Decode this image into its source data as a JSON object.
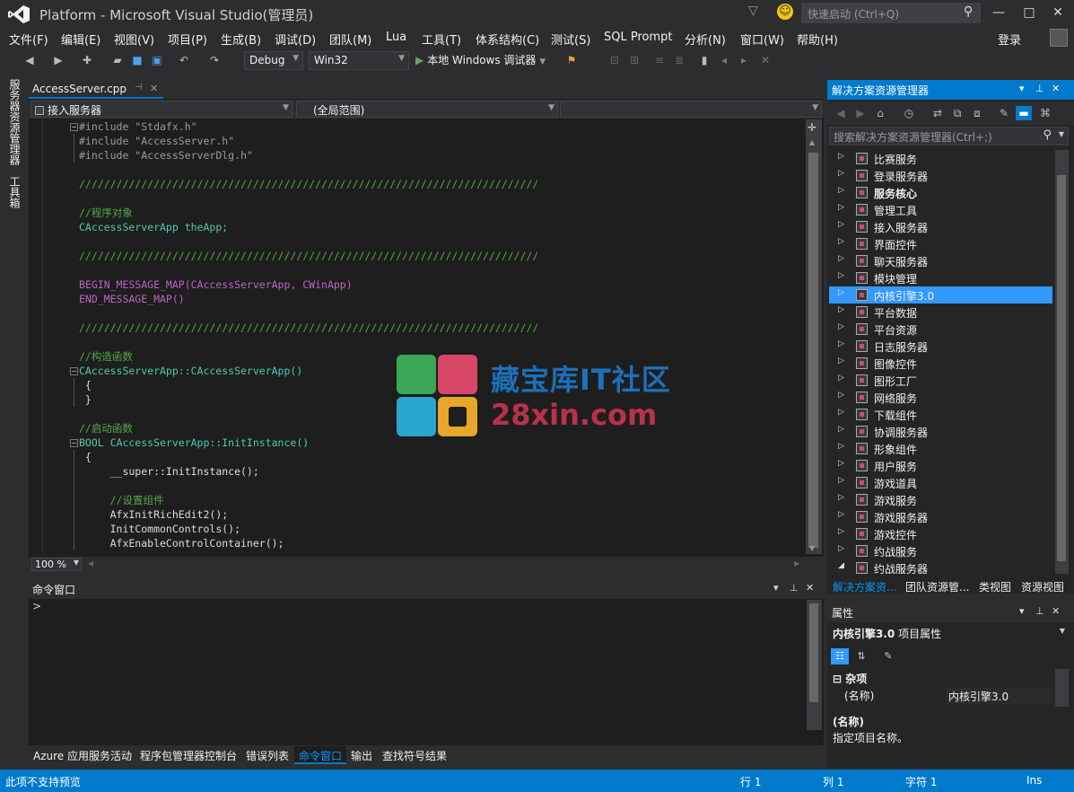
{
  "window": {
    "title": "Platform - Microsoft Visual Studio(管理员)",
    "quick_launch_placeholder": "快速启动 (Ctrl+Q)",
    "sign_in": "登录"
  },
  "menu": [
    "文件(F)",
    "编辑(E)",
    "视图(V)",
    "项目(P)",
    "生成(B)",
    "调试(D)",
    "团队(M)",
    "Lua",
    "工具(T)",
    "体系结构(C)",
    "测试(S)",
    "SQL Prompt",
    "分析(N)",
    "窗口(W)",
    "帮助(H)"
  ],
  "toolbar": {
    "config": "Debug",
    "platform": "Win32",
    "debugger": "本地 Windows 调试器"
  },
  "left_tabs": [
    "服务器资源管理器",
    "工具箱"
  ],
  "editor": {
    "tab": "AccessServer.cpp",
    "scope_left": "接入服务器",
    "scope_mid": "(全局范围)",
    "scope_right": "",
    "zoom": "100 %",
    "lines": [
      {
        "t": "#include \"Stdafx.h\"",
        "k": "pp"
      },
      {
        "t": "#include \"AccessServer.h\"",
        "k": "pp"
      },
      {
        "t": "#include \"AccessServerDlg.h\"",
        "k": "pp"
      },
      {
        "t": "",
        "k": ""
      },
      {
        "t": "//////////////////////////////////////////////////////////////////////////",
        "k": "cm"
      },
      {
        "t": "",
        "k": ""
      },
      {
        "t": "//程序对象",
        "k": "cm"
      },
      {
        "t": "CAccessServerApp theApp;",
        "k": "ty"
      },
      {
        "t": "",
        "k": ""
      },
      {
        "t": "//////////////////////////////////////////////////////////////////////////",
        "k": "cm"
      },
      {
        "t": "",
        "k": ""
      },
      {
        "t": "BEGIN_MESSAGE_MAP(CAccessServerApp, CWinApp)",
        "k": "mac"
      },
      {
        "t": "END_MESSAGE_MAP()",
        "k": "mac"
      },
      {
        "t": "",
        "k": ""
      },
      {
        "t": "//////////////////////////////////////////////////////////////////////////",
        "k": "cm"
      },
      {
        "t": "",
        "k": ""
      },
      {
        "t": "//构造函数",
        "k": "cm"
      },
      {
        "t": "CAccessServerApp::CAccessServerApp()",
        "k": "ty"
      },
      {
        "t": " {",
        "k": ""
      },
      {
        "t": " }",
        "k": ""
      },
      {
        "t": "",
        "k": ""
      },
      {
        "t": "//启动函数",
        "k": "cm"
      },
      {
        "t": "BOOL CAccessServerApp::InitInstance()",
        "k": "ty"
      },
      {
        "t": " {",
        "k": ""
      },
      {
        "t": "     __super::InitInstance();",
        "k": ""
      },
      {
        "t": "",
        "k": ""
      },
      {
        "t": "     //设置组件",
        "k": "cm"
      },
      {
        "t": "     AfxInitRichEdit2();",
        "k": ""
      },
      {
        "t": "     InitCommonControls();",
        "k": ""
      },
      {
        "t": "     AfxEnableControlContainer();",
        "k": ""
      }
    ]
  },
  "command_window": {
    "title": "命令窗口",
    "prompt": ">"
  },
  "bottom_tabs": [
    "Azure 应用服务活动",
    "程序包管理器控制台",
    "错误列表",
    "命令窗口",
    "输出",
    "查找符号结果"
  ],
  "bottom_tabs_active": 3,
  "solution_explorer": {
    "title": "解决方案资源管理器",
    "search_placeholder": "搜索解决方案资源管理器(Ctrl+;)",
    "items": [
      {
        "label": "比赛服务",
        "bold": false,
        "expanded": false
      },
      {
        "label": "登录服务器",
        "bold": false,
        "expanded": false
      },
      {
        "label": "服务核心",
        "bold": true,
        "expanded": false
      },
      {
        "label": "管理工具",
        "bold": false,
        "expanded": false
      },
      {
        "label": "接入服务器",
        "bold": false,
        "expanded": false
      },
      {
        "label": "界面控件",
        "bold": false,
        "expanded": false
      },
      {
        "label": "聊天服务器",
        "bold": false,
        "expanded": false
      },
      {
        "label": "模块管理",
        "bold": false,
        "expanded": false
      },
      {
        "label": "内核引擎3.0",
        "bold": false,
        "expanded": false,
        "selected": true
      },
      {
        "label": "平台数据",
        "bold": false,
        "expanded": false
      },
      {
        "label": "平台资源",
        "bold": false,
        "expanded": false
      },
      {
        "label": "日志服务器",
        "bold": false,
        "expanded": false
      },
      {
        "label": "图像控件",
        "bold": false,
        "expanded": false
      },
      {
        "label": "图形工厂",
        "bold": false,
        "expanded": false
      },
      {
        "label": "网络服务",
        "bold": false,
        "expanded": false
      },
      {
        "label": "下载组件",
        "bold": false,
        "expanded": false
      },
      {
        "label": "协调服务器",
        "bold": false,
        "expanded": false
      },
      {
        "label": "形象组件",
        "bold": false,
        "expanded": false
      },
      {
        "label": "用户服务",
        "bold": false,
        "expanded": false
      },
      {
        "label": "游戏道具",
        "bold": false,
        "expanded": false
      },
      {
        "label": "游戏服务",
        "bold": false,
        "expanded": false
      },
      {
        "label": "游戏服务器",
        "bold": false,
        "expanded": false
      },
      {
        "label": "游戏控件",
        "bold": false,
        "expanded": false
      },
      {
        "label": "约战服务",
        "bold": false,
        "expanded": false
      },
      {
        "label": "约战服务器",
        "bold": false,
        "expanded": true
      }
    ],
    "tabs": [
      "解决方案资...",
      "团队资源管...",
      "类视图",
      "资源视图"
    ]
  },
  "properties": {
    "title": "属性",
    "object_name": "内核引擎3.0",
    "object_type": "项目属性",
    "category": "杂项",
    "key": "(名称)",
    "value": "内核引擎3.0",
    "desc_title": "(名称)",
    "desc": "指定项目名称。"
  },
  "status": {
    "message": "此项不支持预览",
    "line": "行 1",
    "col": "列 1",
    "char": "字符 1",
    "mode": "Ins"
  },
  "watermark": {
    "line1": "藏宝库IT社区",
    "line2": "28xin.com"
  }
}
